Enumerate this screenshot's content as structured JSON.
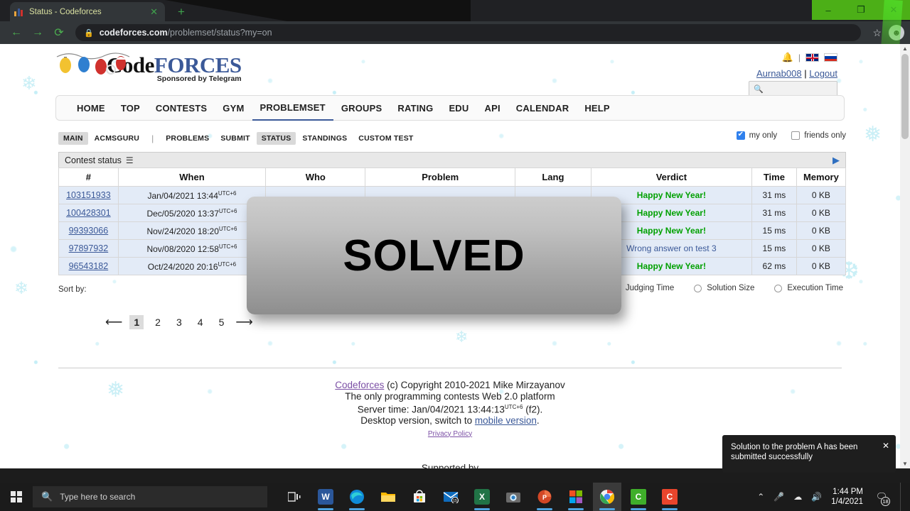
{
  "browser": {
    "tab_title": "Status - Codeforces",
    "tab_close_icon": "close-icon",
    "new_tab_icon": "plus-icon",
    "back_icon": "arrow-left-icon",
    "forward_icon": "arrow-right-icon",
    "reload_icon": "reload-icon",
    "lock_icon": "lock-icon",
    "url_domain": "codeforces.com",
    "url_path": "/problemset/status?my=on",
    "star_icon": "star-icon",
    "profile_icon": "avatar-icon",
    "minimize_label": "–",
    "maximize_label": "❐",
    "close_label": "✕"
  },
  "site": {
    "logo_code": "Code",
    "logo_forces": "FORCES",
    "logo_sub": "Sponsored by Telegram",
    "bell_icon": "bell-icon",
    "divider": "|",
    "flag_en": "flag-uk-icon",
    "flag_ru": "flag-russia-icon",
    "username": "Aurnab008",
    "logout": "Logout",
    "search_placeholder": "",
    "search_icon": "search-icon"
  },
  "nav": {
    "items": [
      {
        "label": "HOME",
        "active": false
      },
      {
        "label": "TOP",
        "active": false
      },
      {
        "label": "CONTESTS",
        "active": false
      },
      {
        "label": "GYM",
        "active": false
      },
      {
        "label": "PROBLEMSET",
        "active": true
      },
      {
        "label": "GROUPS",
        "active": false
      },
      {
        "label": "RATING",
        "active": false
      },
      {
        "label": "EDU",
        "active": false
      },
      {
        "label": "API",
        "active": false
      },
      {
        "label": "CALENDAR",
        "active": false
      },
      {
        "label": "HELP",
        "active": false
      }
    ]
  },
  "subnav": {
    "items": [
      {
        "label": "MAIN",
        "selected": true
      },
      {
        "label": "ACMSGURU",
        "selected": false
      }
    ],
    "items2": [
      {
        "label": "PROBLEMS",
        "selected": false
      },
      {
        "label": "SUBMIT",
        "selected": false
      },
      {
        "label": "STATUS",
        "selected": true
      },
      {
        "label": "STANDINGS",
        "selected": false
      },
      {
        "label": "CUSTOM TEST",
        "selected": false
      }
    ],
    "my_only": "my only",
    "my_only_checked": true,
    "friends_only": "friends only",
    "friends_only_checked": false
  },
  "status_panel": {
    "title": "Contest status",
    "list_icon": "list-icon",
    "expand_icon": "caret-right-icon"
  },
  "table": {
    "columns": [
      "#",
      "When",
      "Who",
      "Problem",
      "Lang",
      "Verdict",
      "Time",
      "Memory"
    ],
    "rows": [
      {
        "id": "103151933",
        "when": "Jan/04/2021 13:44",
        "tz": "UTC+6",
        "who": "",
        "problem": "",
        "lang": "",
        "verdict": "Happy New Year!",
        "verdict_type": "ok",
        "time": "31 ms",
        "memory": "0 KB"
      },
      {
        "id": "100428301",
        "when": "Dec/05/2020 13:37",
        "tz": "UTC+6",
        "who": "",
        "problem": "",
        "lang": "",
        "verdict": "Happy New Year!",
        "verdict_type": "ok",
        "time": "31 ms",
        "memory": "0 KB"
      },
      {
        "id": "99393066",
        "when": "Nov/24/2020 18:20",
        "tz": "UTC+6",
        "who": "",
        "problem": "",
        "lang": "",
        "verdict": "Happy New Year!",
        "verdict_type": "ok",
        "time": "15 ms",
        "memory": "0 KB"
      },
      {
        "id": "97897932",
        "when": "Nov/08/2020 12:58",
        "tz": "UTC+6",
        "who": "",
        "problem": "",
        "lang": "",
        "verdict": "Wrong answer on test 3",
        "verdict_type": "wa",
        "time": "15 ms",
        "memory": "0 KB"
      },
      {
        "id": "96543182",
        "when": "Oct/24/2020 20:16",
        "tz": "UTC+6",
        "who": "",
        "problem": "",
        "lang": "",
        "verdict": "Happy New Year!",
        "verdict_type": "ok",
        "time": "62 ms",
        "memory": "0 KB"
      }
    ]
  },
  "sort": {
    "label": "Sort by:",
    "options": [
      {
        "label": "Judging Time",
        "selected": true
      },
      {
        "label": "Solution Size",
        "selected": false
      },
      {
        "label": "Execution Time",
        "selected": false
      }
    ]
  },
  "pagination": {
    "prev_icon": "arrow-left-long-icon",
    "next_icon": "arrow-right-long-icon",
    "pages": [
      "1",
      "2",
      "3",
      "4",
      "5"
    ],
    "current": "1"
  },
  "overlay": {
    "text": "SOLVED"
  },
  "footer": {
    "link": "Codeforces",
    "copyright": " (c) Copyright 2010-2021 Mike Mirzayanov",
    "line2": "The only programming contests Web 2.0 platform",
    "server_time_label": "Server time: ",
    "server_time": "Jan/04/2021 13:44:13",
    "server_tz": "UTC+6",
    "server_suffix": " (f2).",
    "desktop_prefix": "Desktop version, switch to ",
    "mobile_link": "mobile version",
    "desktop_suffix": ".",
    "privacy": "Privacy Policy",
    "supported": "Supported by"
  },
  "toast": {
    "message": "Solution to the problem A has been submitted successfully",
    "close_icon": "close-icon"
  },
  "taskbar": {
    "start_icon": "windows-start-icon",
    "search_icon": "search-icon",
    "search_placeholder": "Type here to search",
    "taskview_icon": "task-view-icon",
    "apps": [
      {
        "name": "word-icon",
        "glyph": "W",
        "color": "#2b579a",
        "running": true,
        "active": false
      },
      {
        "name": "edge-icon",
        "glyph": "",
        "color": "#0f8bd8",
        "running": true,
        "active": false
      },
      {
        "name": "file-explorer-icon",
        "glyph": "",
        "color": "#ffb900",
        "running": false,
        "active": false
      },
      {
        "name": "microsoft-store-icon",
        "glyph": "",
        "color": "#f2f2f2",
        "running": false,
        "active": false
      },
      {
        "name": "mail-icon",
        "glyph": "15",
        "color": "#0078d7",
        "running": false,
        "active": false
      },
      {
        "name": "excel-icon",
        "glyph": "X",
        "color": "#217346",
        "running": true,
        "active": false
      },
      {
        "name": "camera-icon",
        "glyph": "",
        "color": "#6b6b6b",
        "running": false,
        "active": false
      },
      {
        "name": "powerpoint-icon",
        "glyph": "P",
        "color": "#d24726",
        "running": true,
        "active": false
      },
      {
        "name": "microsoft-office-icon",
        "glyph": "",
        "color": "#f25022",
        "running": true,
        "active": false
      },
      {
        "name": "chrome-icon",
        "glyph": "",
        "color": "#4285f4",
        "running": true,
        "active": true
      },
      {
        "name": "app-green-c-icon",
        "glyph": "C",
        "color": "#3fae2a",
        "running": true,
        "active": false
      },
      {
        "name": "app-red-c-icon",
        "glyph": "C",
        "color": "#e8452c",
        "running": true,
        "active": false
      }
    ],
    "chevron_icon": "chevron-up-icon",
    "mic_icon": "microphone-icon",
    "cloud_icon": "onedrive-icon",
    "volume_icon": "volume-icon",
    "time": "1:44 PM",
    "date": "1/4/2021",
    "notif_icon": "notification-icon",
    "notif_count": "18"
  }
}
